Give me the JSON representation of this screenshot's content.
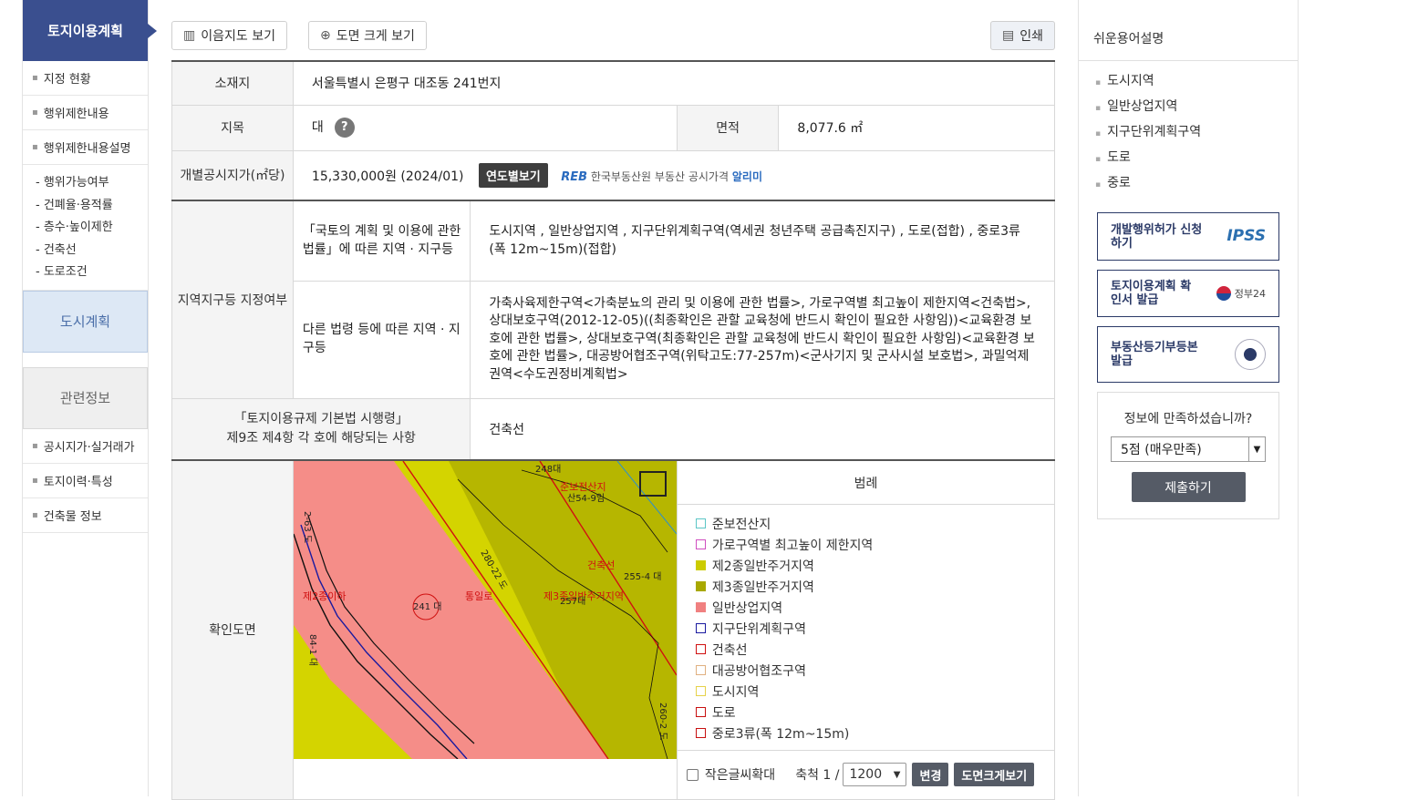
{
  "leftnav": {
    "title": "토지이용계획",
    "items_top": [
      "지정 현황",
      "행위제한내용",
      "행위제한내용설명"
    ],
    "sub_items": [
      "- 행위가능여부",
      "- 건폐율·용적률",
      "- 층수·높이제한",
      "- 건축선",
      "- 도로조건"
    ],
    "block_city": "도시계획",
    "block_related": "관련정보",
    "items_bottom": [
      "공시지가·실거래가",
      "토지이력·특성",
      "건축물 정보"
    ]
  },
  "toolbar": {
    "map_btn": "이음지도 보기",
    "zoom_btn": "도면 크게 보기",
    "print_btn": "인쇄"
  },
  "info": {
    "location_label": "소재지",
    "location_value": "서울특별시 은평구 대조동 241번지",
    "jimok_label": "지목",
    "jimok_value": "대",
    "qmark": "?",
    "area_label": "면적",
    "area_value": "8,077.6 ㎡",
    "price_label": "개별공시지가(㎡당)",
    "price_value": "15,330,000원 (2024/01)",
    "year_btn": "연도별보기",
    "reb_logo": "REB",
    "reb_org": "한국부동산원",
    "reb_text": "부동산 공시가격",
    "reb_app": "알리미",
    "zone_label": "지역지구등 지정여부",
    "national_law_label": "「국토의 계획 및 이용에 관한 법률」에 따른 지역 · 지구등",
    "national_law_value": "도시지역 , 일반상업지역 , 지구단위계획구역(역세권 청년주택 공급촉진지구) , 도로(접합) , 중로3류(폭 12m~15m)(접합)",
    "other_law_label": "다른 법령 등에 따른 지역 · 지구등",
    "other_law_value": "가축사육제한구역<가축분뇨의 관리 및 이용에 관한 법률>, 가로구역별 최고높이 제한지역<건축법>, 상대보호구역(2012-12-05)((최종확인은 관할 교육청에 반드시 확인이 필요한 사항임))<교육환경 보호에 관한 법률>, 상대보호구역(최종확인은 관할 교육청에 반드시 확인이 필요한 사항임)<교육환경 보호에 관한 법률>, 대공방어협조구역(위탁고도:77-257m)<군사기지 및 군사시설 보호법>, 과밀억제권역<수도권정비계획법>",
    "enforcement_label_1": "「토지이용규제 기본법 시행령」",
    "enforcement_label_2": "제9조 제4항 각 호에 해당되는 사항",
    "enforcement_value": "건축선",
    "map_label": "확인도면"
  },
  "map": {
    "labels": [
      "248대",
      "준보전산지",
      "산54-9임",
      "2-63 도",
      "280-22 도",
      "건축선",
      "255-4 대",
      "제2종이하",
      "241 대",
      "통일로",
      "제3종일반주거지역",
      "257대",
      "84-1 대",
      "260-2 도"
    ]
  },
  "legend": {
    "title": "범례",
    "items": [
      {
        "label": "준보전산지",
        "color": "#5cc6c6",
        "fill": "none"
      },
      {
        "label": "가로구역별 최고높이 제한지역",
        "color": "#d04fc0",
        "fill": "none"
      },
      {
        "label": "제2종일반주거지역",
        "color": "#cccc00",
        "fill": "#cccc00"
      },
      {
        "label": "제3종일반주거지역",
        "color": "#a8a800",
        "fill": "#a8a800"
      },
      {
        "label": "일반상업지역",
        "color": "#f08080",
        "fill": "#f08080"
      },
      {
        "label": "지구단위계획구역",
        "color": "#1a1aa0",
        "fill": "none"
      },
      {
        "label": "건축선",
        "color": "#d01010",
        "fill": "none"
      },
      {
        "label": "대공방어협조구역",
        "color": "#e0b080",
        "fill": "none"
      },
      {
        "label": "도시지역",
        "color": "#e6d24a",
        "fill": "none"
      },
      {
        "label": "도로",
        "color": "#c81010",
        "fill": "none"
      },
      {
        "label": "중로3류(폭 12m~15m)",
        "color": "#c81010",
        "fill": "none"
      }
    ]
  },
  "mapfoot": {
    "small_text": "작은글씨확대",
    "scale_label": "축척 1 /",
    "scale_value": "1200",
    "change_btn": "변경",
    "big_btn": "도면크게보기"
  },
  "right": {
    "title": "쉬운용어설명",
    "terms": [
      "도시지역",
      "일반상업지역",
      "지구단위계획구역",
      "도로",
      "중로"
    ],
    "box1": "개발행위허가 신청하기",
    "box1_logo": "IPSS",
    "box2": "토지이용계획 확인서 발급",
    "box2_logo": "정부24",
    "box3": "부동산등기부등본 발급",
    "survey_q": "정보에 만족하셨습니까?",
    "survey_value": "5점 (매우만족)",
    "submit": "제출하기"
  }
}
